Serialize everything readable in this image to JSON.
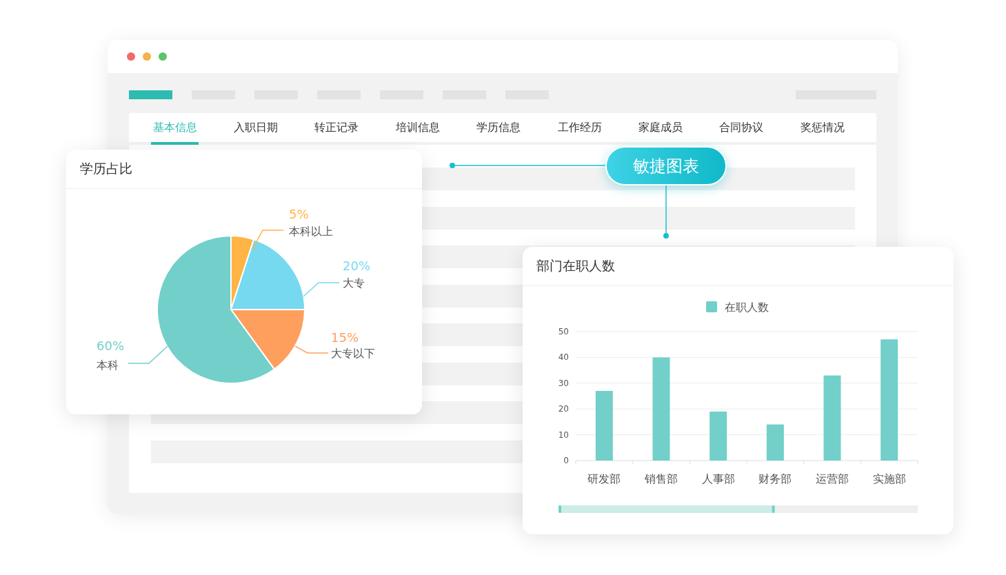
{
  "window": {
    "nav_placeholders": [
      {
        "selected": true
      },
      {
        "selected": false
      },
      {
        "selected": false
      },
      {
        "selected": false
      },
      {
        "selected": false
      },
      {
        "selected": false
      },
      {
        "selected": false
      }
    ]
  },
  "tabs": [
    {
      "label": "基本信息",
      "selected": true
    },
    {
      "label": "入职日期",
      "selected": false
    },
    {
      "label": "转正记录",
      "selected": false
    },
    {
      "label": "培训信息",
      "selected": false
    },
    {
      "label": "学历信息",
      "selected": false
    },
    {
      "label": "工作经历",
      "selected": false
    },
    {
      "label": "家庭成员",
      "selected": false
    },
    {
      "label": "合同协议",
      "selected": false
    },
    {
      "label": "奖惩情况",
      "selected": false
    }
  ],
  "callout": {
    "label": "敏捷图表"
  },
  "education_card": {
    "title": "学历占比",
    "chart_data": {
      "type": "pie",
      "categories": [
        "本科以上",
        "大专",
        "大专以下",
        "本科"
      ],
      "series": [
        {
          "values": [
            5,
            20,
            15,
            60
          ]
        }
      ],
      "colors": [
        "#ffb443",
        "#76d9f0",
        "#ff9f5e",
        "#72cfc9"
      ]
    },
    "percent_labels": [
      "5%",
      "20%",
      "15%",
      "60%"
    ]
  },
  "department_card": {
    "title": "部门在职人数",
    "chart_data": {
      "type": "bar",
      "categories": [
        "研发部",
        "销售部",
        "人事部",
        "财务部",
        "运营部",
        "实施部"
      ],
      "series": [
        {
          "name": "在职人数",
          "color": "#72cfc9",
          "values": [
            27,
            40,
            19,
            14,
            33,
            47
          ]
        }
      ],
      "ylim": [
        0,
        50
      ],
      "yticks": [
        0,
        10,
        20,
        30,
        40,
        50
      ],
      "grid": true
    },
    "zoom_slider": {
      "level": 0.6
    }
  }
}
